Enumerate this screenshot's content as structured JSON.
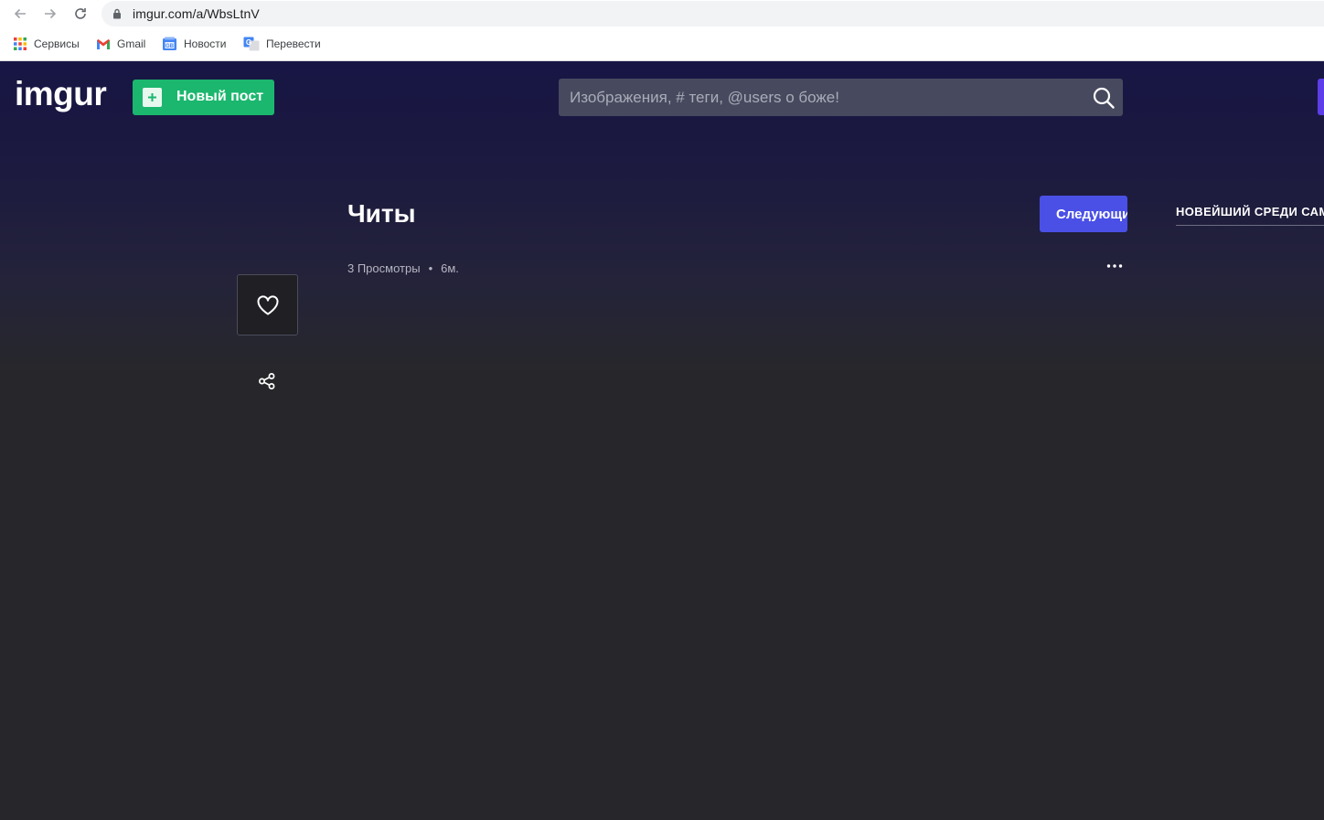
{
  "browser": {
    "url": "imgur.com/a/WbsLtnV",
    "bookmarks": [
      {
        "label": "Сервисы",
        "icon": "apps-grid-icon"
      },
      {
        "label": "Gmail",
        "icon": "gmail-icon"
      },
      {
        "label": "Новости",
        "icon": "news-icon"
      },
      {
        "label": "Перевести",
        "icon": "translate-icon"
      }
    ]
  },
  "header": {
    "logo": "imgur",
    "new_post_label": "Новый пост",
    "search_placeholder": "Изображения, # теги, @users о боже!"
  },
  "post": {
    "title": "Читы",
    "views": "3 Просмотры",
    "separator": "•",
    "age": "6м.",
    "next_label": "Следующий"
  },
  "sidebar": {
    "heading": "НОВЕЙШИЙ СРЕДИ САМЫХ"
  },
  "colors": {
    "header_bg": "#171544",
    "page_bg": "#27272b",
    "new_post_green": "#1bb76e",
    "next_blue": "#4a50e6",
    "search_bg": "#474a5e"
  }
}
